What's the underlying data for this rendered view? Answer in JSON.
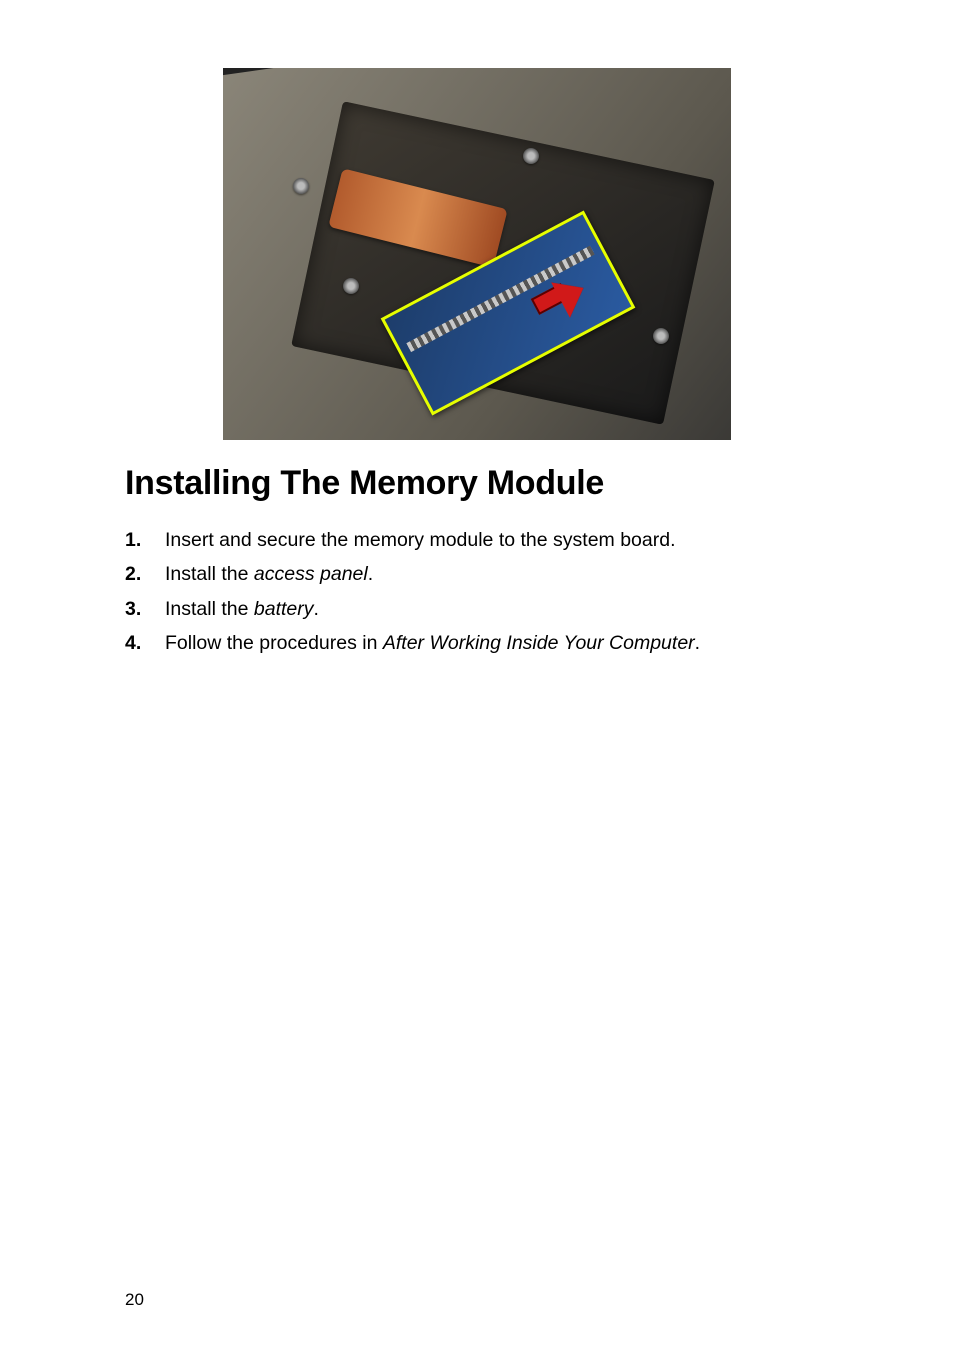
{
  "figure_alt": "Close-up photo of a laptop interior showing a SODIMM memory module highlighted in yellow with a red arrow indicating removal direction from its slot on the system board.",
  "heading": "Installing The Memory Module",
  "steps": [
    {
      "num": "1.",
      "text_before": "Insert and secure the memory module to the system board.",
      "italic": "",
      "text_after": ""
    },
    {
      "num": "2.",
      "text_before": "Install the ",
      "italic": "access panel",
      "text_after": "."
    },
    {
      "num": "3.",
      "text_before": "Install the ",
      "italic": "battery",
      "text_after": "."
    },
    {
      "num": "4.",
      "text_before": "Follow the procedures in ",
      "italic": "After Working Inside Your Computer",
      "text_after": "."
    }
  ],
  "page_number": "20"
}
